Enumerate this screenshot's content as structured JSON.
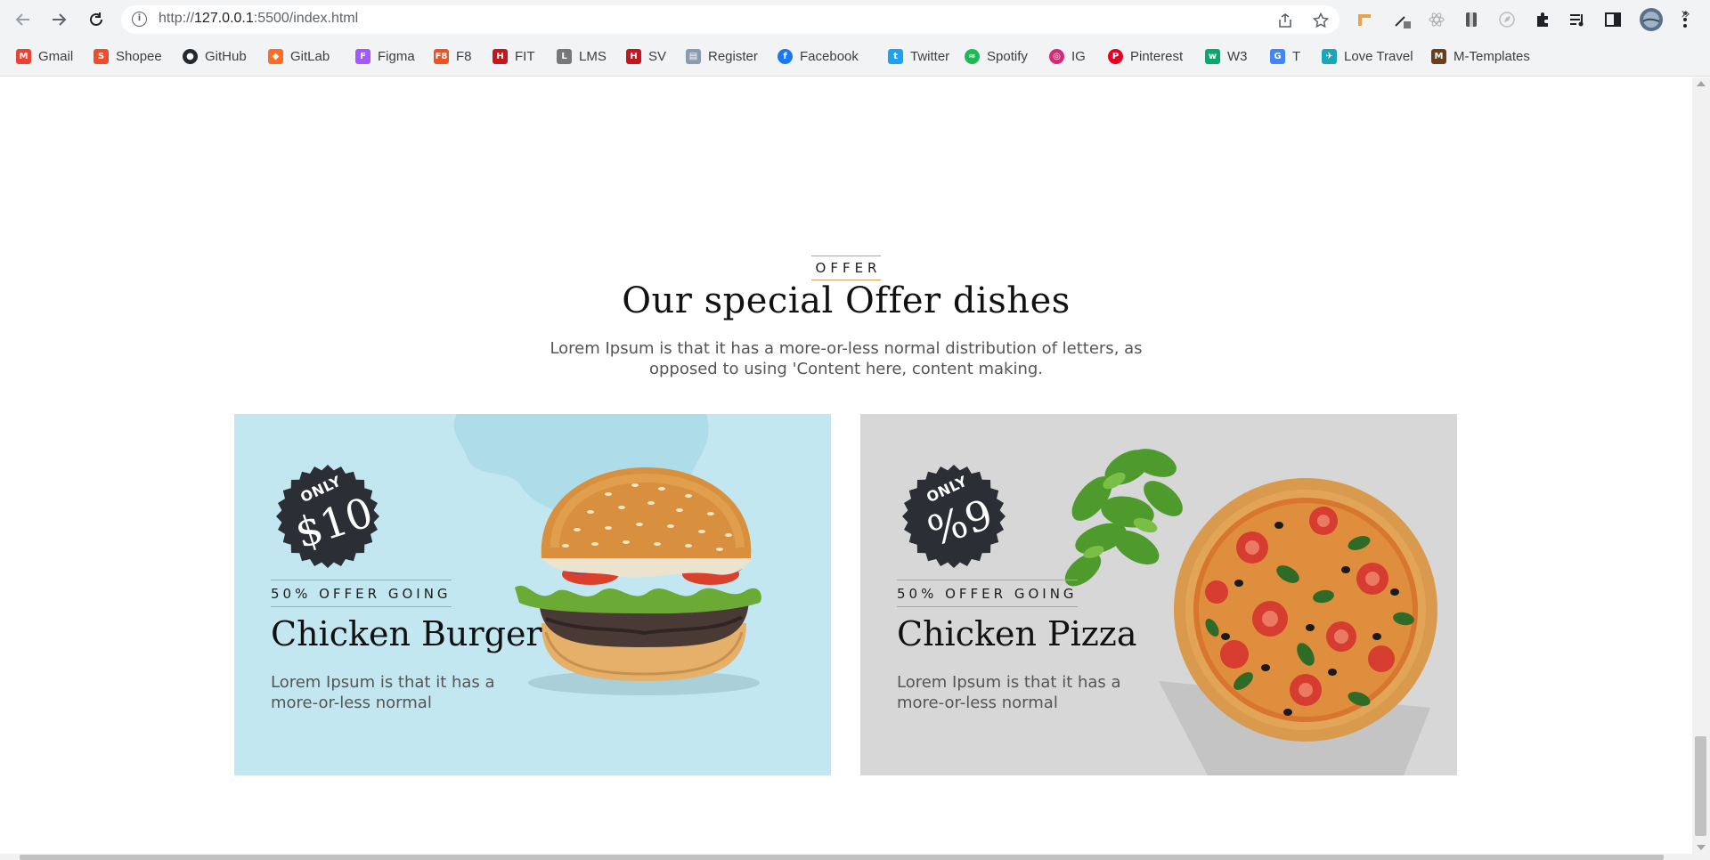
{
  "browser": {
    "url_host": "127.0.0.1",
    "url_path": ":5500/index.html",
    "url_scheme": "http://",
    "bookmarks": [
      {
        "label": "Gmail",
        "icon": "gmail-icon",
        "color": "#ea4335"
      },
      {
        "label": "Shopee",
        "icon": "shopee-icon",
        "color": "#ee4d2d"
      },
      {
        "label": "GitHub",
        "icon": "github-icon",
        "color": "#24292e"
      },
      {
        "label": "GitLab",
        "icon": "gitlab-icon",
        "color": "#fc6d26"
      },
      {
        "label": "Figma",
        "icon": "figma-icon",
        "color": "#a259ff"
      },
      {
        "label": "F8",
        "icon": "f8-icon",
        "color": "#f05123"
      },
      {
        "label": "FIT",
        "icon": "fit-icon",
        "color": "#c4161c"
      },
      {
        "label": "LMS",
        "icon": "lms-icon",
        "color": "#777777"
      },
      {
        "label": "SV",
        "icon": "sv-icon",
        "color": "#c4161c"
      },
      {
        "label": "Register",
        "icon": "register-icon",
        "color": "#8a9bb0"
      },
      {
        "label": "Facebook",
        "icon": "facebook-icon",
        "color": "#1877f2"
      },
      {
        "label": "Twitter",
        "icon": "twitter-icon",
        "color": "#1da1f2"
      },
      {
        "label": "Spotify",
        "icon": "spotify-icon",
        "color": "#1db954"
      },
      {
        "label": "IG",
        "icon": "instagram-icon",
        "color": "#d62976"
      },
      {
        "label": "Pinterest",
        "icon": "pinterest-icon",
        "color": "#e60023"
      },
      {
        "label": "W3",
        "icon": "w3schools-icon",
        "color": "#04aa6d"
      },
      {
        "label": "T",
        "icon": "translate-icon",
        "color": "#4285f4"
      },
      {
        "label": "Love Travel",
        "icon": "love-travel-icon",
        "color": "#1aa6b7"
      },
      {
        "label": "M-Templates",
        "icon": "m-templates-icon",
        "color": "#6b3e1e"
      }
    ]
  },
  "offer": {
    "tag": "OFFER",
    "title": "Our special Offer dishes",
    "description": "Lorem Ipsum is that it has a more-or-less normal distribution of letters, as opposed to using 'Content here, content making.",
    "cards": [
      {
        "badge_only": "ONLY",
        "badge_price": "$10",
        "tag": "50% OFFER GOING",
        "title": "Chicken Burger",
        "description": "Lorem Ipsum is that it has a more-or-less normal",
        "background": "#c3e7f0"
      },
      {
        "badge_only": "ONLY",
        "badge_price": "%9",
        "tag": "50% OFFER GOING",
        "title": "Chicken Pizza",
        "description": "Lorem Ipsum is that it has a more-or-less normal",
        "background": "#d7d7d7"
      }
    ]
  },
  "colors": {
    "accent_gold": "#d4a05a",
    "badge_dark": "#2b2e35"
  }
}
